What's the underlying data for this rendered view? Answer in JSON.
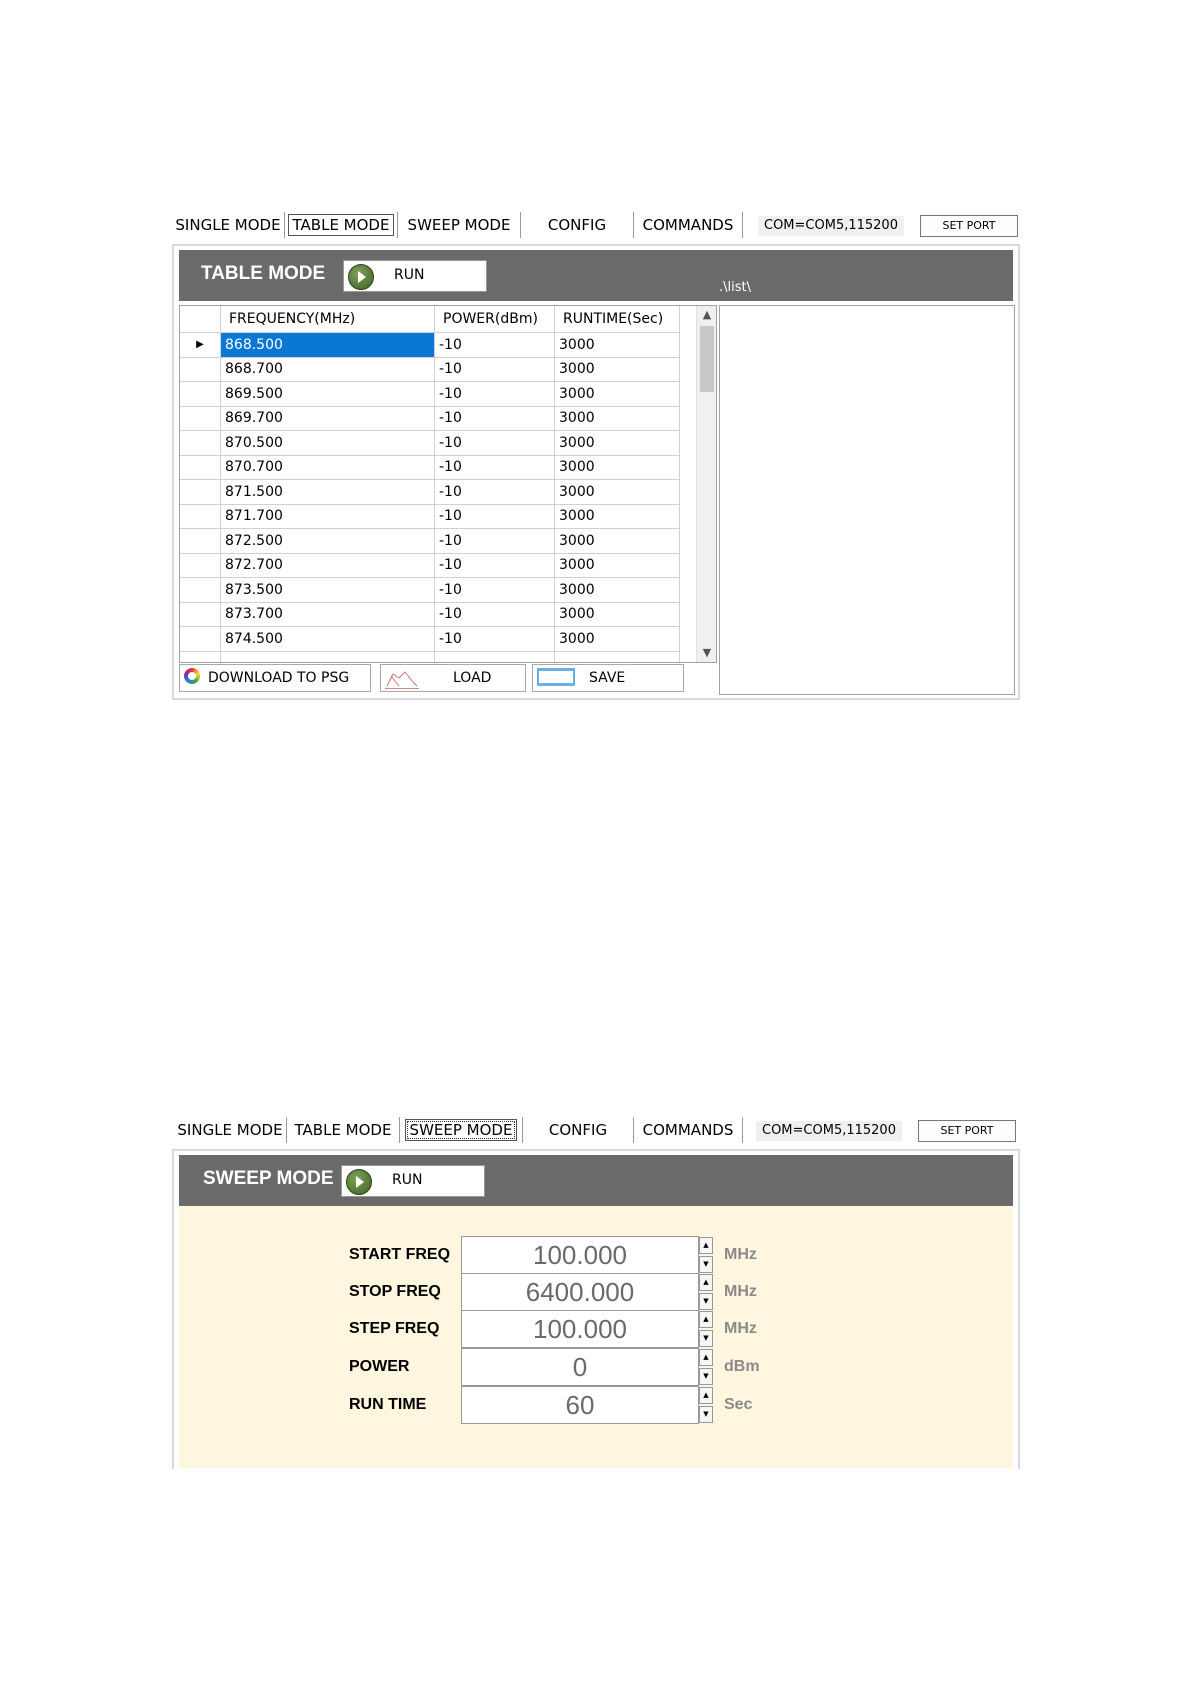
{
  "tabs": [
    {
      "label": "SINGLE MODE"
    },
    {
      "label": "TABLE MODE"
    },
    {
      "label": "SWEEP MODE"
    },
    {
      "label": "CONFIG"
    },
    {
      "label": "COMMANDS"
    }
  ],
  "com_status": "COM=COM5,115200",
  "set_port_label": "SET PORT",
  "table_panel": {
    "active_tab": "TABLE MODE",
    "title": "TABLE MODE",
    "run_label": "RUN",
    "list_path": ".\\list\\",
    "columns": [
      "FREQUENCY(MHz)",
      "POWER(dBm)",
      "RUNTIME(Sec)"
    ],
    "rows": [
      [
        "868.500",
        "-10",
        "3000"
      ],
      [
        "868.700",
        "-10",
        "3000"
      ],
      [
        "869.500",
        "-10",
        "3000"
      ],
      [
        "869.700",
        "-10",
        "3000"
      ],
      [
        "870.500",
        "-10",
        "3000"
      ],
      [
        "870.700",
        "-10",
        "3000"
      ],
      [
        "871.500",
        "-10",
        "3000"
      ],
      [
        "871.700",
        "-10",
        "3000"
      ],
      [
        "872.500",
        "-10",
        "3000"
      ],
      [
        "872.700",
        "-10",
        "3000"
      ],
      [
        "873.500",
        "-10",
        "3000"
      ],
      [
        "873.700",
        "-10",
        "3000"
      ],
      [
        "874.500",
        "-10",
        "3000"
      ]
    ],
    "selected_row_marker": "▶",
    "download_label": "DOWNLOAD TO PSG",
    "load_label": "LOAD",
    "save_label": "SAVE"
  },
  "sweep_panel": {
    "active_tab": "SWEEP MODE",
    "title": "SWEEP MODE",
    "run_label": "RUN",
    "fields": [
      {
        "label": "START FREQ",
        "value": "100.000",
        "unit": "MHz"
      },
      {
        "label": "STOP FREQ",
        "value": "6400.000",
        "unit": "MHz"
      },
      {
        "label": "STEP FREQ",
        "value": "100.000",
        "unit": "MHz"
      },
      {
        "label": "POWER",
        "value": "0",
        "unit": "dBm"
      },
      {
        "label": "RUN TIME",
        "value": "60",
        "unit": "Sec"
      }
    ]
  },
  "colors": {
    "header_bg": "#6a6a6a",
    "selection": "#0a77d6",
    "sweep_bg": "#fef6df"
  }
}
